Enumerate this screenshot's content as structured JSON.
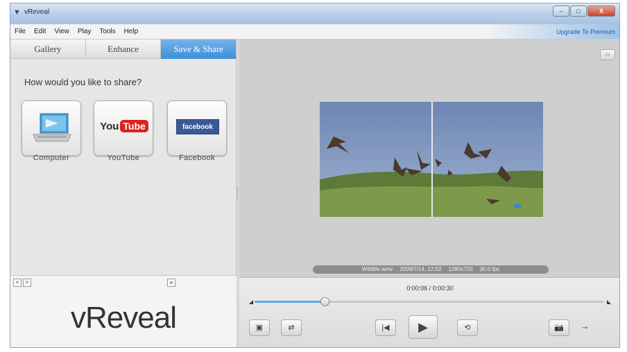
{
  "window": {
    "title": "vReveal",
    "app_icon": "vreveal-logo-icon",
    "minimize": "–",
    "maximize": "□",
    "close": "X"
  },
  "menu": {
    "items": [
      "File",
      "Edit",
      "View",
      "Play",
      "Tools",
      "Help"
    ],
    "upgrade": "Upgrade To Premium"
  },
  "tabs": [
    {
      "label": "Gallery",
      "active": false
    },
    {
      "label": "Enhance",
      "active": false
    },
    {
      "label": "Save & Share",
      "active": true
    }
  ],
  "share": {
    "question": "How would you like to share?",
    "options": [
      {
        "label": "Computer",
        "icon": "laptop-icon"
      },
      {
        "label": "YouTube",
        "icon": "youtube-logo-icon",
        "logo_you": "You",
        "logo_tube": "Tube"
      },
      {
        "label": "Facebook",
        "icon": "facebook-logo-icon",
        "logo_text": "facebook"
      }
    ]
  },
  "ad": {
    "prev": "<",
    "next": ">",
    "close": "×",
    "logo": "vReveal"
  },
  "viewer": {
    "fit_button": "▭",
    "info": {
      "filename": "Wildlife.wmv",
      "datetime": "2009/7/14, 12:52",
      "resolution": "1280x720",
      "fps": "30.0 fps"
    }
  },
  "controls": {
    "timecode": "0:00:06 / 0:00:30",
    "progress_fraction": 0.2,
    "buttons": {
      "compare": "▣",
      "export": "⇄",
      "prev_frame": "|◀",
      "play": "▶",
      "loop": "⟲",
      "snapshot": "📷",
      "plug": "⊸"
    }
  },
  "colors": {
    "accent": "#3f8fd6",
    "facebook": "#3b5998",
    "youtube": "#d9261c"
  }
}
